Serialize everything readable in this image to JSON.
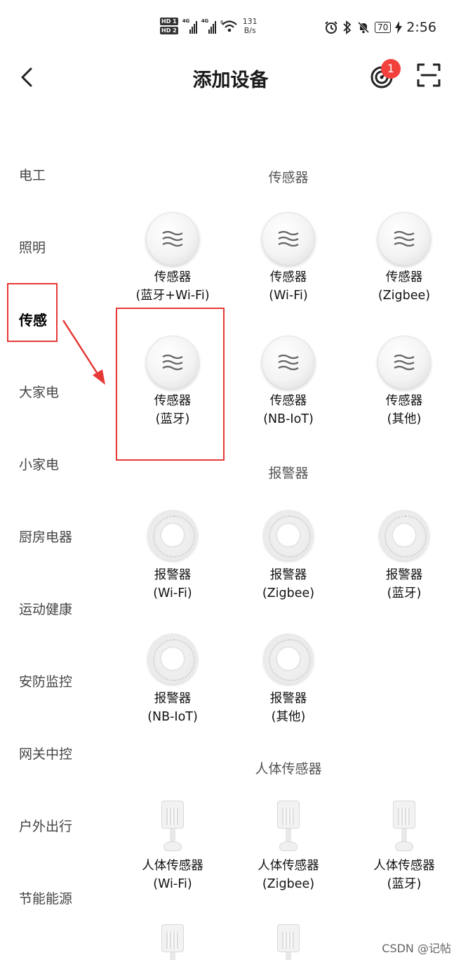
{
  "status_bar": {
    "hd1": "HD 1",
    "hd2": "HD 2",
    "sig1_tag": "4G",
    "sig2_tag": "4G",
    "wifi_tag": "6",
    "speed_value": "131",
    "speed_unit": "B/s",
    "battery": "70",
    "time": "2:56"
  },
  "nav": {
    "title": "添加设备",
    "badge_count": "1"
  },
  "sidebar": {
    "items": [
      "电工",
      "照明",
      "传感",
      "大家电",
      "小家电",
      "厨房电器",
      "运动健康",
      "安防监控",
      "网关中控",
      "户外出行",
      "节能能源"
    ],
    "active": "传感"
  },
  "sections": [
    {
      "title": "传感器",
      "devices": [
        {
          "line1": "传感器",
          "line2": "(蓝牙+Wi-Fi)",
          "icon": "sensor-icon"
        },
        {
          "line1": "传感器",
          "line2": "(Wi-Fi)",
          "icon": "sensor-icon"
        },
        {
          "line1": "传感器",
          "line2": "(Zigbee)",
          "icon": "sensor-icon"
        },
        {
          "line1": "传感器",
          "line2": "(蓝牙)",
          "icon": "sensor-icon"
        },
        {
          "line1": "传感器",
          "line2": "(NB-IoT)",
          "icon": "sensor-icon"
        },
        {
          "line1": "传感器",
          "line2": "(其他)",
          "icon": "sensor-icon"
        }
      ]
    },
    {
      "title": "报警器",
      "devices": [
        {
          "line1": "报警器",
          "line2": "(Wi-Fi)",
          "icon": "alarm-icon"
        },
        {
          "line1": "报警器",
          "line2": "(Zigbee)",
          "icon": "alarm-icon"
        },
        {
          "line1": "报警器",
          "line2": "(蓝牙)",
          "icon": "alarm-icon"
        },
        {
          "line1": "报警器",
          "line2": "(NB-IoT)",
          "icon": "alarm-icon"
        },
        {
          "line1": "报警器",
          "line2": "(其他)",
          "icon": "alarm-icon"
        }
      ]
    },
    {
      "title": "人体传感器",
      "devices": [
        {
          "line1": "人体传感器",
          "line2": "(Wi-Fi)",
          "icon": "motion-sensor-icon"
        },
        {
          "line1": "人体传感器",
          "line2": "(Zigbee)",
          "icon": "motion-sensor-icon"
        },
        {
          "line1": "人体传感器",
          "line2": "(蓝牙)",
          "icon": "motion-sensor-icon"
        }
      ]
    }
  ],
  "watermark": "CSDN @记帖",
  "colors": {
    "badge": "#f2403d",
    "annotation_red": "#e53935",
    "background": "#ffffff"
  }
}
